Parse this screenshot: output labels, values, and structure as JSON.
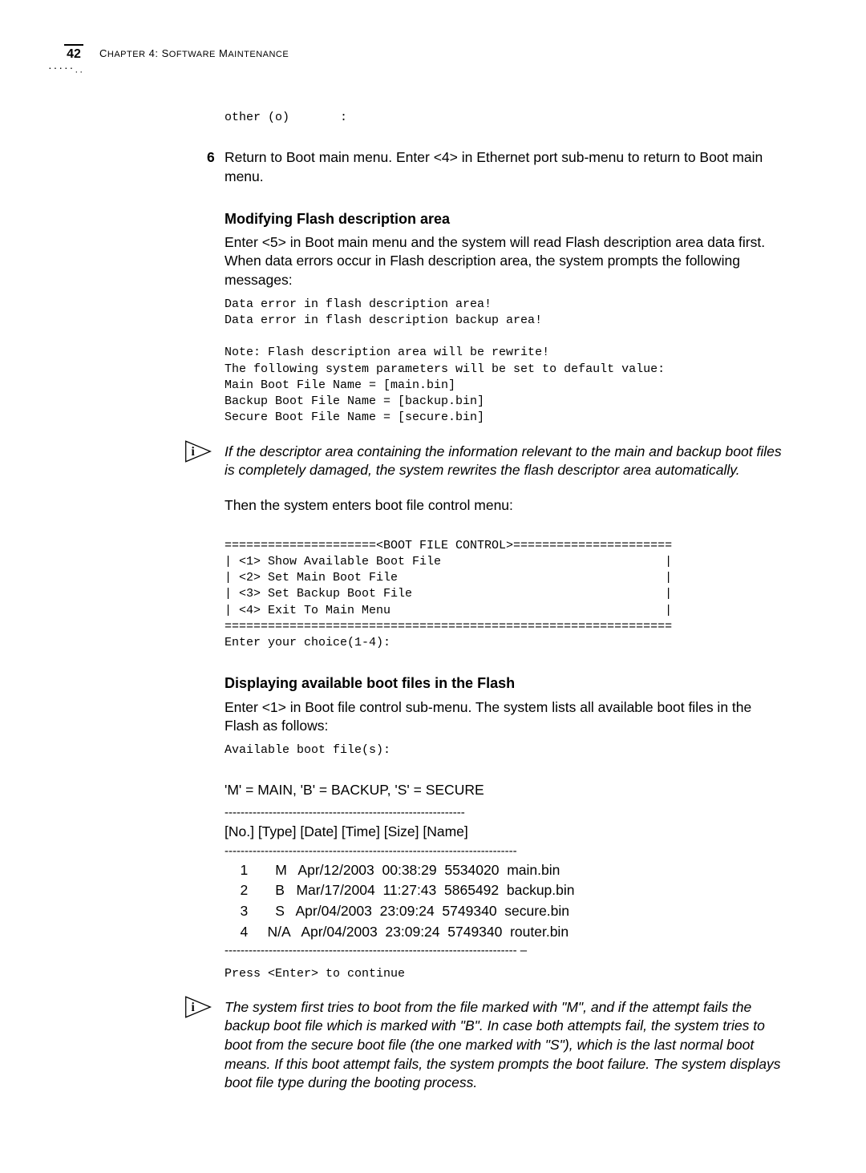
{
  "header": {
    "page_number": "42",
    "chapter_prefix": "C",
    "chapter_text": "HAPTER",
    "chapter_num": " 4: S",
    "chapter_rest": "OFTWARE",
    "chapter_m": " M",
    "chapter_end": "AINTENANCE"
  },
  "code1": "other (o)       :",
  "step6_num": "6",
  "step6_text": "Return to Boot main menu. Enter <4> in Ethernet port sub-menu to return to Boot main menu.",
  "heading1": "Modifying Flash description area",
  "para1": "Enter <5> in Boot main menu and the system will read Flash description area data first. When data errors occur in Flash description area, the system prompts the following messages:",
  "code2": "Data error in flash description area!\nData error in flash description backup area!\n\nNote: Flash description area will be rewrite!\nThe following system parameters will be set to default value:\nMain Boot File Name = [main.bin]\nBackup Boot File Name = [backup.bin]\nSecure Boot File Name = [secure.bin]",
  "note1": "If the descriptor area containing the information relevant to the main and backup boot files is completely damaged, the system rewrites the flash descriptor area automatically.",
  "para2": "Then the system enters boot file control menu:",
  "code3": "=====================<BOOT FILE CONTROL>======================\n| <1> Show Available Boot File                               |\n| <2> Set Main Boot File                                     |\n| <3> Set Backup Boot File                                   |\n| <4> Exit To Main Menu                                      |\n==============================================================\nEnter your choice(1-4):",
  "heading2": "Displaying available boot files in the Flash",
  "para3": "Enter <1> in Boot file control sub-menu. The system lists all available boot files in the Flash as follows:",
  "code4": "Available boot file(s):",
  "legend": "'M' = MAIN, 'B' = BACKUP, 'S' = SECURE",
  "table_hdr_line": "------------------------------------------------------------",
  "table_header": "[No.]  [Type]     [Date]   [Time]  [Size]  [Name]",
  "table_sep": "-------------------------------------------------------------------------",
  "row1": "    1       M   Apr/12/2003  00:38:29  5534020  main.bin",
  "row2": "    2       B   Mar/17/2004  11:27:43  5865492  backup.bin",
  "row3": "    3       S   Apr/04/2003  23:09:24  5749340  secure.bin",
  "row4": "    4     N/A   Apr/04/2003  23:09:24  5749340  router.bin",
  "table_end": "------------------------------------------------------------------------- –",
  "code5": "Press <Enter> to continue",
  "note2": "The system first tries to boot from the file marked with \"M\", and if the attempt fails the backup boot file which is marked with \"B\". In case both attempts fail, the system tries to boot from the secure boot file (the one marked with \"S\"), which is the last normal boot means. If this boot attempt fails, the system prompts the boot failure. The system displays boot file type during the booting process."
}
